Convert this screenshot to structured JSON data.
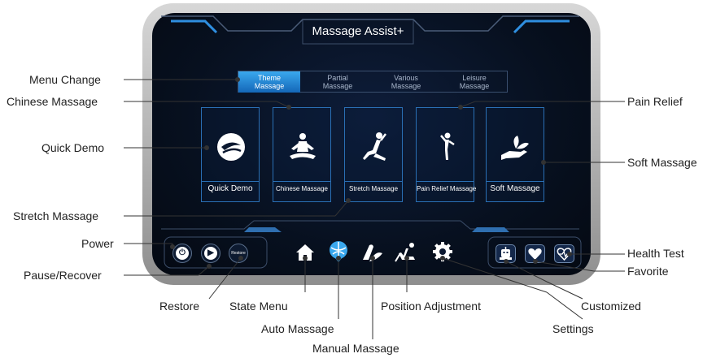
{
  "screen": {
    "title": "Massage Assist+"
  },
  "tabs": [
    {
      "line1": "Theme",
      "line2": "Massage",
      "active": true
    },
    {
      "line1": "Partial",
      "line2": "Massage",
      "active": false
    },
    {
      "line1": "Various",
      "line2": "Massage",
      "active": false
    },
    {
      "line1": "Leisure",
      "line2": "Massage",
      "active": false
    }
  ],
  "cards": [
    {
      "label": "Quick Demo",
      "icon": "quick-demo-icon"
    },
    {
      "label": "Chinese Massage",
      "icon": "meditation-icon"
    },
    {
      "label": "Stretch Massage",
      "icon": "stretch-icon"
    },
    {
      "label": "Pain Relief Massage",
      "icon": "pain-relief-icon"
    },
    {
      "label": "Soft Massage",
      "icon": "hand-leaf-icon"
    }
  ],
  "bottom": {
    "restore_label": "Restore"
  },
  "callouts": {
    "menu_change": "Menu Change",
    "chinese_massage": "Chinese Massage",
    "quick_demo": "Quick Demo",
    "stretch_massage": "Stretch Massage",
    "power": "Power",
    "pause_recover": "Pause/Recover",
    "restore": "Restore",
    "state_menu": "State Menu",
    "auto_massage": "Auto Massage",
    "manual_massage": "Manual Massage",
    "position_adjustment": "Position Adjustment",
    "settings": "Settings",
    "customized": "Customized",
    "favorite": "Favorite",
    "health_test": "Health Test",
    "soft_massage": "Soft Massage",
    "pain_relief": "Pain Relief"
  }
}
